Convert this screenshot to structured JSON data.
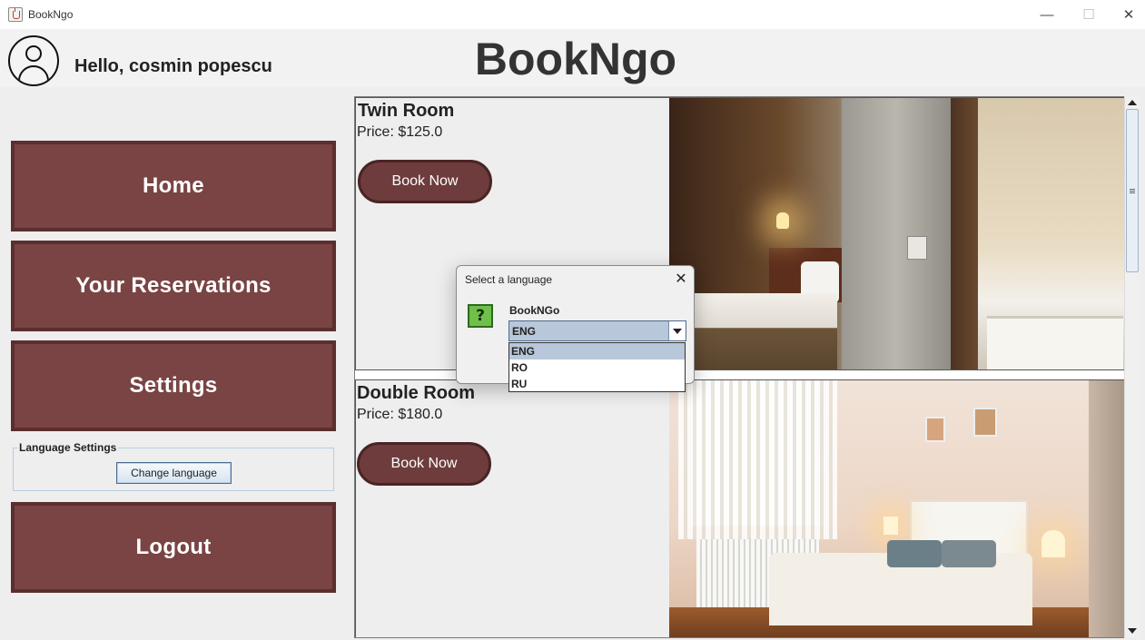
{
  "window": {
    "title": "BookNgo",
    "minimize_symbol": "—",
    "maximize_symbol": "☐",
    "close_symbol": "✕",
    "icon": "java-cup-icon"
  },
  "header": {
    "greeting": "Hello, cosmin popescu",
    "brand": "BookNgo",
    "avatar_icon": "user-avatar-icon"
  },
  "sidebar": {
    "home": "Home",
    "reservations": "Your Reservations",
    "settings": "Settings",
    "language_group_title": "Language Settings",
    "change_language": "Change language",
    "logout": "Logout"
  },
  "rooms": [
    {
      "name": "Twin Room",
      "price": "Price: $125.0",
      "book_label": "Book Now"
    },
    {
      "name": "Double Room",
      "price": "Price: $180.0",
      "book_label": "Book Now"
    }
  ],
  "dialog": {
    "title": "Select a language",
    "close_symbol": "✕",
    "question_icon": "?",
    "message": "BookNGo",
    "selected": "ENG",
    "options": [
      "ENG",
      "RO",
      "RU"
    ]
  },
  "colors": {
    "accent": "#7a4444",
    "accent_border": "#5b2f2f",
    "selection": "#b8c7d9"
  }
}
